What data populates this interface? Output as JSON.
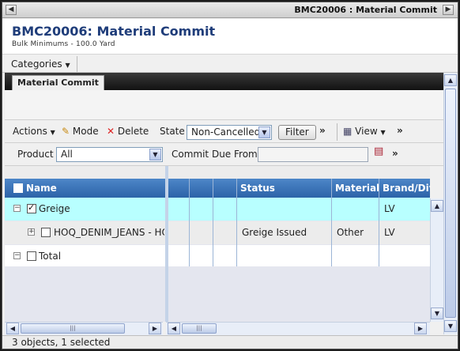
{
  "titlebar": {
    "title": "BMC20006 : Material Commit",
    "back_glyph": "◀",
    "forward_glyph": "▶"
  },
  "header": {
    "title": "BMC20006: Material Commit",
    "subtitle": "Bulk Minimums - 100.0 Yard"
  },
  "categories": {
    "label": "Categories"
  },
  "tab": {
    "label": "Material Commit"
  },
  "toolbar": {
    "actions": "Actions",
    "mode": "Mode",
    "delete": "Delete",
    "state_label": "State",
    "state_value": "Non-Cancelled",
    "filter": "Filter",
    "view": "View",
    "more": "»"
  },
  "filterbar": {
    "product_label": "Product",
    "product_value": "All",
    "commit_due_label": "Commit Due From",
    "commit_due_value": ""
  },
  "grid": {
    "columns": {
      "name": "Name",
      "status": "Status",
      "material": "Material",
      "brand": "Brand/Divis"
    },
    "rows": [
      {
        "name": "Greige",
        "status": "",
        "material": "",
        "brand": "LV",
        "checked": true,
        "expander": "−",
        "selected": true
      },
      {
        "name": "HOQ_DENIM_JEANS - HO",
        "status": "Greige Issued",
        "material": "Other",
        "brand": "LV",
        "checked": false,
        "expander": "+",
        "selected": false
      },
      {
        "name": "Total",
        "status": "",
        "material": "",
        "brand": "",
        "checked": false,
        "expander": "−",
        "selected": false
      }
    ]
  },
  "statusbar": {
    "text": "3 objects, 1 selected"
  },
  "colors": {
    "header_blue": "#2c63a8",
    "selected_row": "#b8ffff",
    "title_text": "#1f3d7a"
  }
}
